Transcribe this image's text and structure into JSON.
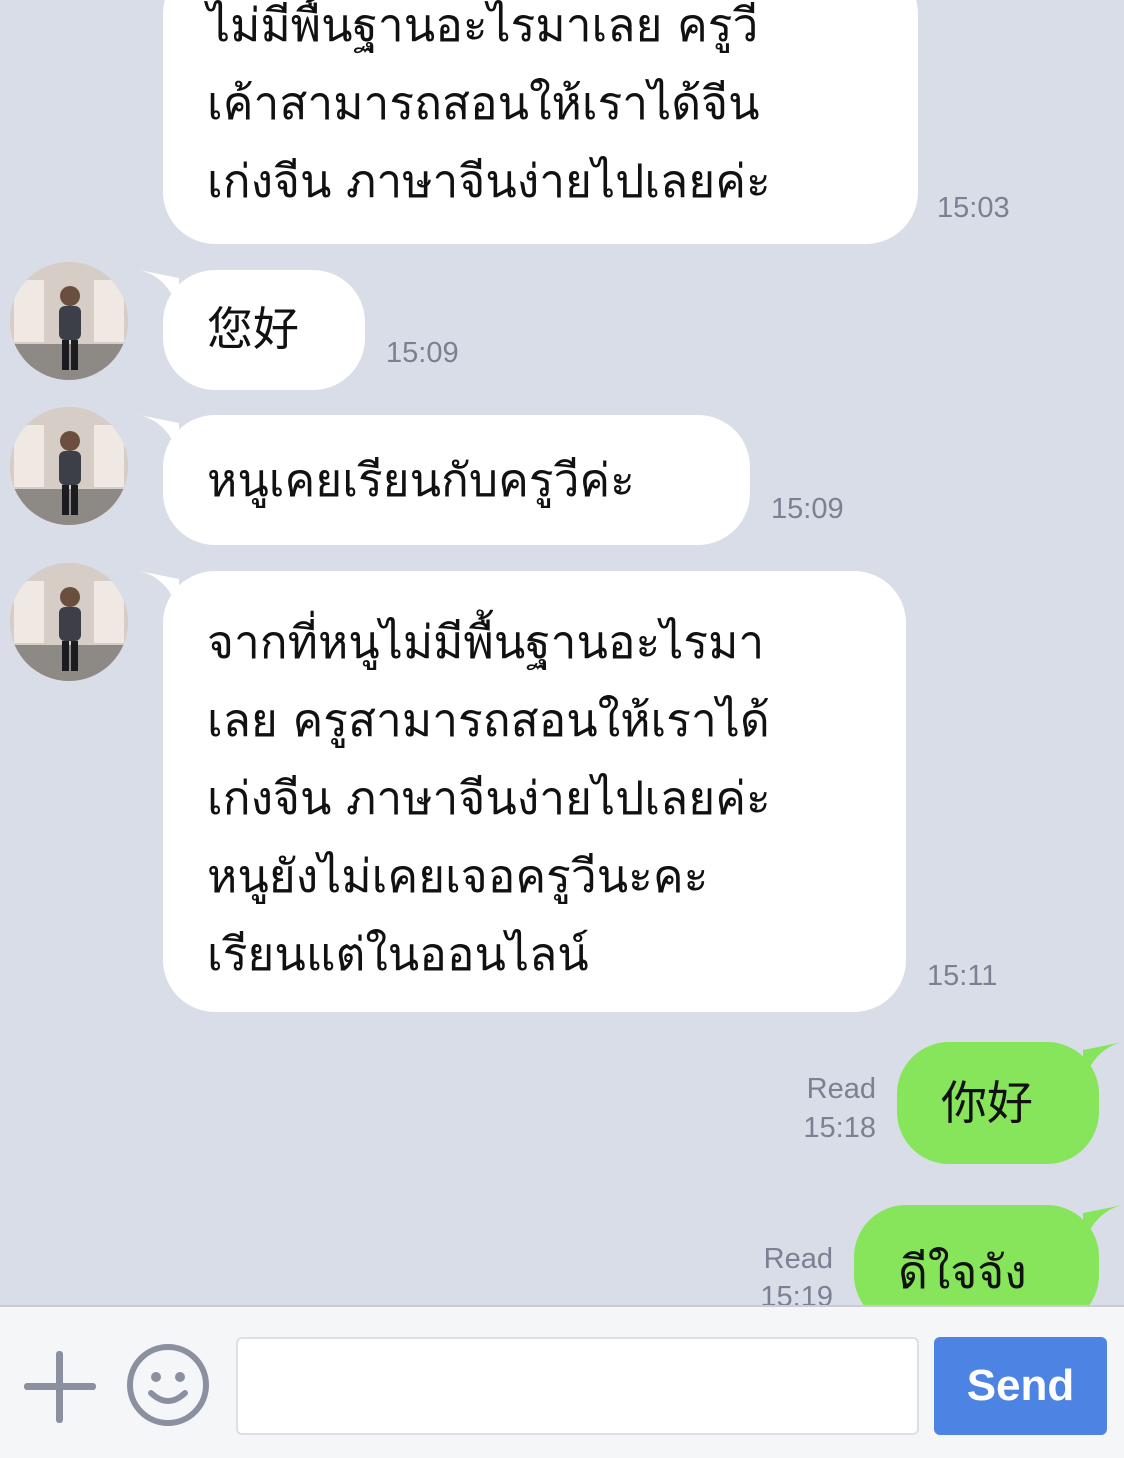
{
  "messages": [
    {
      "lines": [
        "ไม่มีพื้นฐานอะไรมาเลย ครูวี",
        "เค้าสามารถสอนให้เราได้จีน",
        "เก่งจีน ภาษาจีนง่ายไปเลยค่ะ"
      ],
      "time": "15:03"
    },
    {
      "text": "您好",
      "time": "15:09"
    },
    {
      "text": "หนูเคยเรียนกับครูวีค่ะ",
      "time": "15:09"
    },
    {
      "lines": [
        "จากที่หนูไม่มีพื้นฐานอะไรมา",
        "เลย ครูสามารถสอนให้เราได้",
        "เก่งจีน ภาษาจีนง่ายไปเลยค่ะ",
        "หนูยังไม่เคยเจอครูวีนะคะ",
        "เรียนแต่ในออนไลน์"
      ],
      "time": "15:11"
    },
    {
      "text": "你好",
      "status": "Read",
      "time": "15:18"
    },
    {
      "text": "ดีใจจัง",
      "status": "Read",
      "time": "15:19"
    }
  ],
  "composer": {
    "placeholder": "",
    "send_label": "Send"
  },
  "icons": {
    "add": "plus-icon",
    "sticker": "smiley-icon"
  },
  "colors": {
    "background": "#d9dde7",
    "received": "#ffffff",
    "sent": "#86e55a",
    "send_button": "#4d84e3"
  }
}
